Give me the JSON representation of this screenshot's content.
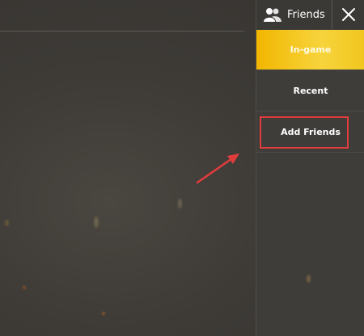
{
  "side_panel": {
    "title": "Friends",
    "icon": "friends-icon",
    "close_icon": "close-icon",
    "tabs": [
      {
        "label": "In-game",
        "state": "active"
      },
      {
        "label": "Recent",
        "state": "inactive"
      },
      {
        "label": "Add Friends",
        "state": "inactive"
      }
    ]
  },
  "annotation": {
    "highlight_color": "#e03c3c",
    "target": "Add Friends"
  },
  "colors": {
    "accent": "#f7d43c",
    "background": "#3e3b37",
    "panel": "#3f3d3a"
  }
}
